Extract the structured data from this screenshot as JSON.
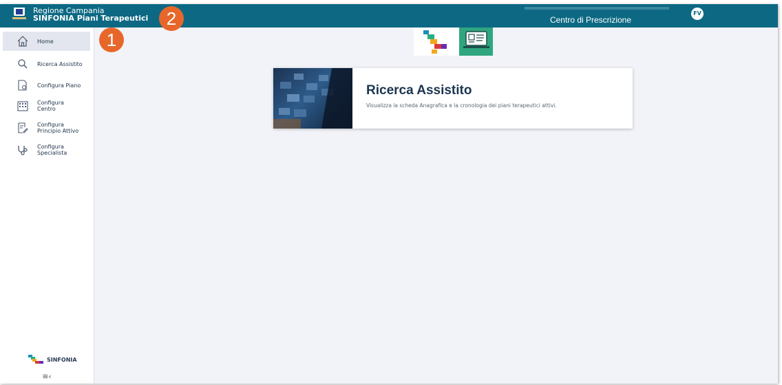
{
  "header": {
    "region": "Regione Campania",
    "app_title": "SINFONIA Piani Terapeutici",
    "center_label": "Centro di Prescrizione",
    "avatar_initials": "FV",
    "color": "#0d6983"
  },
  "annotations": {
    "badge1": "1",
    "badge2": "2",
    "color": "#e7672a"
  },
  "sidebar": {
    "items": [
      {
        "label": "Home",
        "icon": "home-icon"
      },
      {
        "label": "Ricerca Assistito",
        "icon": "search-icon"
      },
      {
        "label": "Configura Piano",
        "icon": "document-gear-icon"
      },
      {
        "label_line1": "Configura",
        "label_line2": "Centro",
        "icon": "building-icon"
      },
      {
        "label_line1": "Configura",
        "label_line2": "Principio Attivo",
        "icon": "document-pen-icon"
      },
      {
        "label_line1": "Configura",
        "label_line2": "Specialista",
        "icon": "stethoscope-icon"
      }
    ],
    "logo_text": "SINFONIA",
    "collapse_icon": "≡‹"
  },
  "main": {
    "card": {
      "title": "Ricerca Assistito",
      "description": "Visualizza la scheda Anagrafica e la cronologia dei piani terapeutici attivi."
    }
  }
}
